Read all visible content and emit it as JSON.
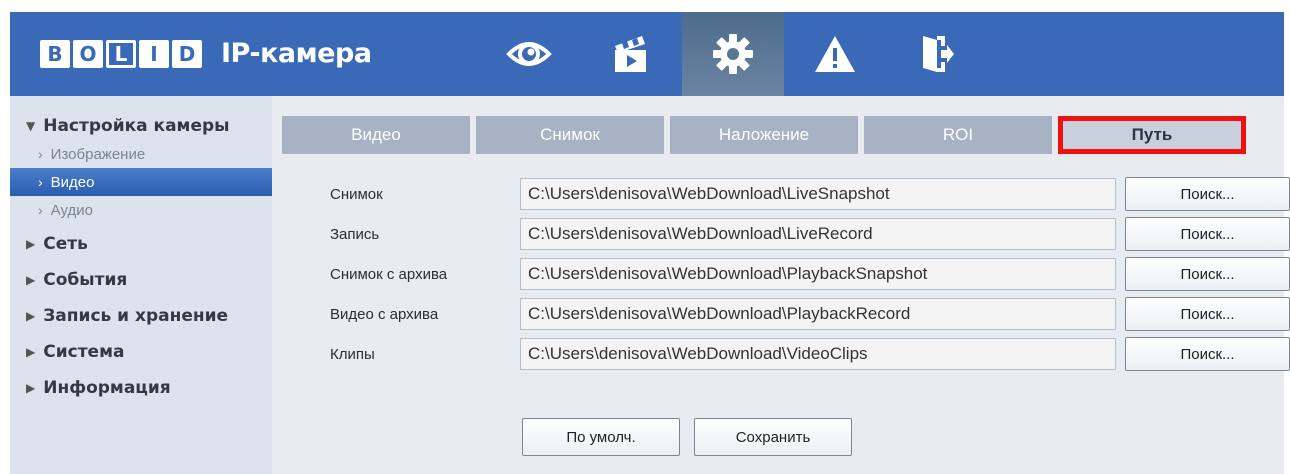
{
  "header": {
    "brand_letters": [
      "B",
      "O",
      "L",
      "I",
      "D"
    ],
    "product": "IP-камера",
    "nav": [
      {
        "icon": "eye-icon",
        "label": "Live view"
      },
      {
        "icon": "clapperboard-icon",
        "label": "Playback"
      },
      {
        "icon": "gear-icon",
        "label": "Settings",
        "active": true
      },
      {
        "icon": "warning-icon",
        "label": "Alarm"
      },
      {
        "icon": "logout-icon",
        "label": "Logout"
      }
    ]
  },
  "sidebar": {
    "camera_group": "Настройка камеры",
    "sub_image": "Изображение",
    "sub_video": "Видео",
    "sub_audio": "Аудио",
    "network": "Сеть",
    "events": "События",
    "record_storage": "Запись и хранение",
    "system": "Система",
    "info": "Информация"
  },
  "tabs": {
    "video": "Видео",
    "snapshot": "Снимок",
    "overlay": "Наложение",
    "roi": "ROI",
    "path": "Путь"
  },
  "paths": {
    "rows": [
      {
        "label": "Снимок",
        "value": "C:\\Users\\denisova\\WebDownload\\LiveSnapshot",
        "button": "Поиск..."
      },
      {
        "label": "Запись",
        "value": "C:\\Users\\denisova\\WebDownload\\LiveRecord",
        "button": "Поиск..."
      },
      {
        "label": "Снимок с архива",
        "value": "C:\\Users\\denisova\\WebDownload\\PlaybackSnapshot",
        "button": "Поиск..."
      },
      {
        "label": "Видео с архива",
        "value": "C:\\Users\\denisova\\WebDownload\\PlaybackRecord",
        "button": "Поиск..."
      },
      {
        "label": "Клипы",
        "value": "C:\\Users\\denisova\\WebDownload\\VideoClips",
        "button": "Поиск..."
      }
    ]
  },
  "actions": {
    "default": "По умолч.",
    "save": "Сохранить"
  },
  "colors": {
    "header": "#3a69b7",
    "active_tab_outline": "#ee1111",
    "active_sidebar": "#2a5eb0"
  }
}
